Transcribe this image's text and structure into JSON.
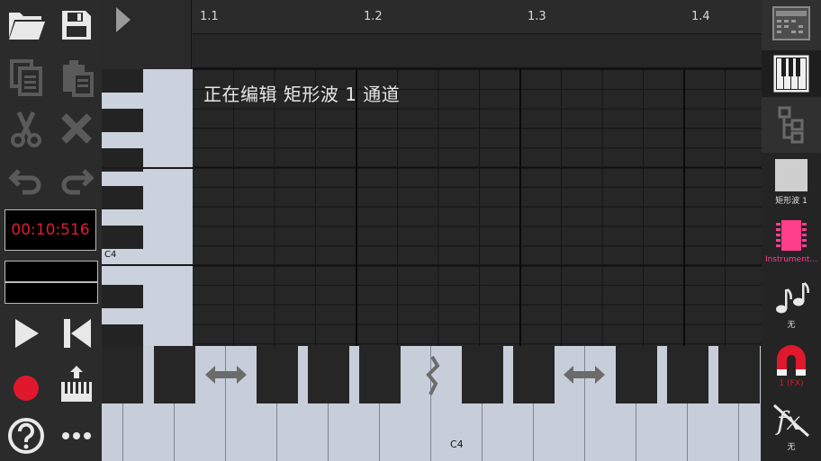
{
  "timeline": {
    "markers": [
      "1.1",
      "1.2",
      "1.3",
      "1.4"
    ]
  },
  "time_display": "00:10:516",
  "editor": {
    "editing_label": "正在编辑 矩形波 1 通道"
  },
  "piano": {
    "vertical_c4_label": "C4",
    "horizontal_c4_label": "C4"
  },
  "right_panel": {
    "channel_label": "矩形波 1",
    "instrument_label": "Instrument...",
    "notes_label": "无",
    "snap_label": "1 (FX)",
    "fx_label": "无"
  },
  "colors": {
    "time_text": "#e21a2c",
    "record": "#e0182c",
    "active_pink": "#ff3f8c",
    "snap_red": "#e0182c",
    "piano_key": "#cbd1dd"
  }
}
